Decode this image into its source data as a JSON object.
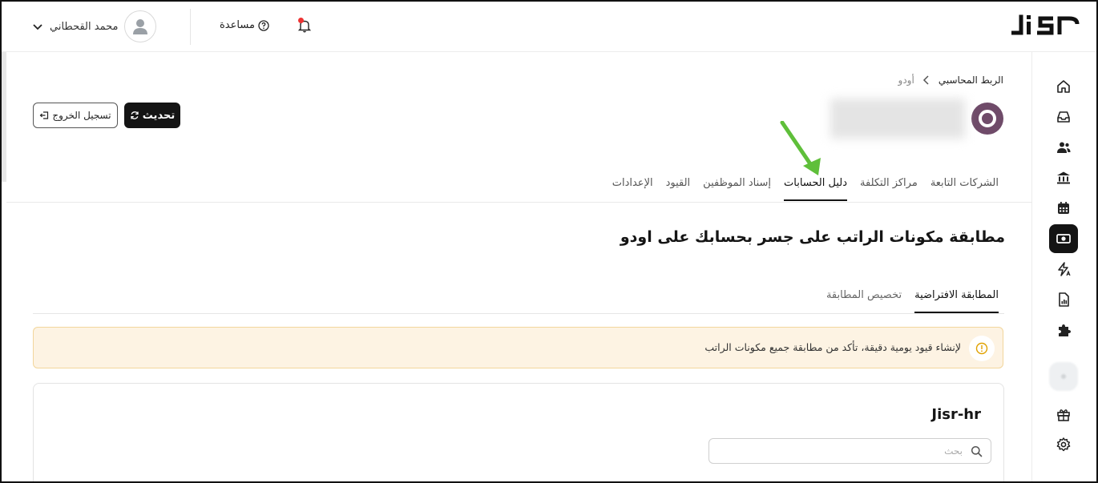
{
  "header": {
    "logo_text": "JISR",
    "user_name": "محمد القحطاني",
    "help_label": "مساعدة",
    "notification_dot_color": "#e33333"
  },
  "breadcrumb": {
    "parent": "الربط المحاسبي",
    "current": "أودو"
  },
  "actions": {
    "refresh_label": "تحديث",
    "logout_label": "تسجيل الخروج"
  },
  "tabs": [
    {
      "label": "الشركات التابعة",
      "active": false
    },
    {
      "label": "مراكز التكلفة",
      "active": false
    },
    {
      "label": "دليل الحسابات",
      "active": true
    },
    {
      "label": "إسناد الموظفين",
      "active": false
    },
    {
      "label": "القيود",
      "active": false
    },
    {
      "label": "الإعدادات",
      "active": false
    }
  ],
  "page_title": "مطابقة مكونات الراتب على جسر بحسابك على اودو",
  "subtabs": [
    {
      "label": "المطابقة الافتراضية",
      "active": true
    },
    {
      "label": "تخصيص المطابقة",
      "active": false
    }
  ],
  "alert": {
    "text": "لإنشاء قيود يومية دقيقة، تأكد من مطابقة جميع مكونات الراتب",
    "icon": "warning-icon"
  },
  "card": {
    "title": "Jisr-hr",
    "search_placeholder": "بحث"
  },
  "sidebar": {
    "items": [
      {
        "icon": "home-icon",
        "active": false
      },
      {
        "icon": "inbox-icon",
        "active": false
      },
      {
        "icon": "people-icon",
        "active": false
      },
      {
        "icon": "bank-icon",
        "active": false
      },
      {
        "icon": "calendar-icon",
        "active": false
      },
      {
        "icon": "payroll-icon",
        "active": true
      },
      {
        "icon": "automation-icon",
        "active": false
      },
      {
        "icon": "report-icon",
        "active": false
      },
      {
        "icon": "puzzle-icon",
        "active": false
      },
      {
        "icon": "app-icon",
        "active": false
      },
      {
        "icon": "gift-icon",
        "active": false
      },
      {
        "icon": "settings-icon",
        "active": false
      }
    ]
  },
  "colors": {
    "accent": "#141414",
    "company_logo": "#6f4b69",
    "alert_bg": "#fdf3e3",
    "alert_border": "#f2d69c",
    "annotation_arrow": "#5fbf3a"
  }
}
